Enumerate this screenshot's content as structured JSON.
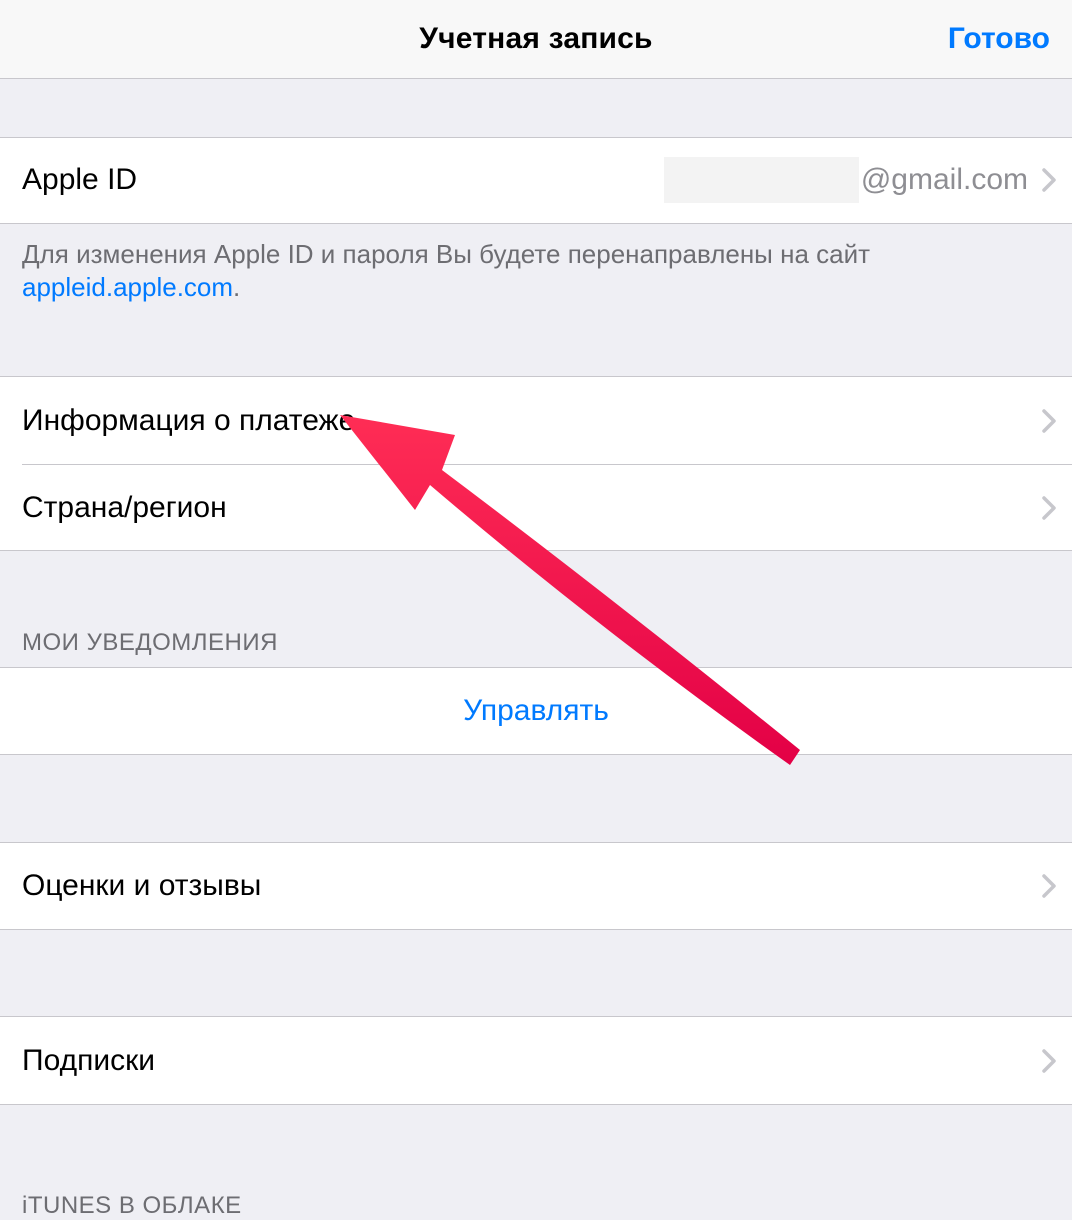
{
  "navbar": {
    "title": "Учетная запись",
    "done": "Готово"
  },
  "apple_id": {
    "label": "Apple ID",
    "value_suffix": "@gmail.com"
  },
  "apple_id_footer": {
    "text_before": "Для изменения Apple ID и пароля Вы будете перенаправлены на сайт ",
    "link": "appleid.apple.com",
    "text_after": "."
  },
  "rows": {
    "payment_info": "Информация о платеже",
    "country_region": "Страна/регион",
    "manage": "Управлять",
    "ratings_reviews": "Оценки и отзывы",
    "subscriptions": "Подписки"
  },
  "sections": {
    "my_notifications": "МОИ УВЕДОМЛЕНИЯ",
    "itunes_cloud": "iTUNES В ОБЛАКЕ"
  },
  "colors": {
    "tint": "#007aff",
    "annotation": "#ef1a55"
  }
}
